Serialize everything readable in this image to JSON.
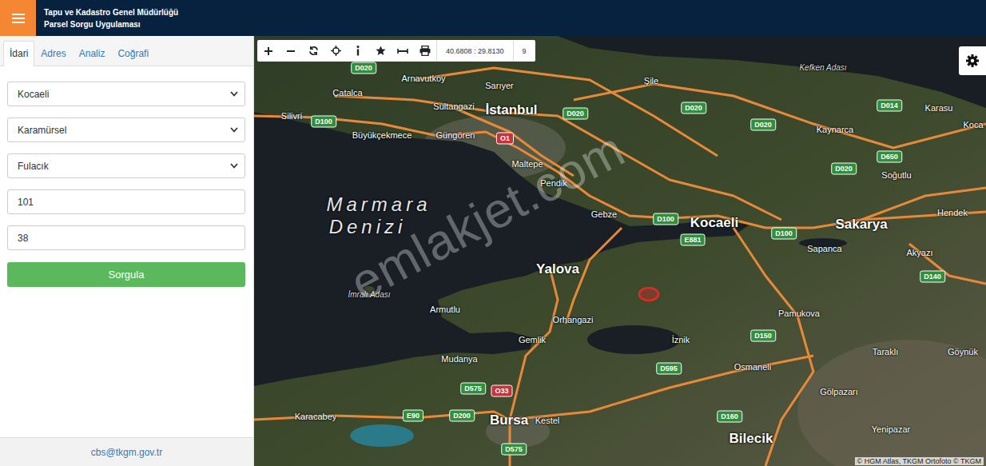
{
  "header": {
    "title_line1": "Tapu ve Kadastro Genel Müdürlüğü",
    "title_line2": "Parsel Sorgu Uygulaması"
  },
  "tabs": [
    {
      "label": "İdari",
      "selected": true
    },
    {
      "label": "Adres",
      "selected": false
    },
    {
      "label": "Analiz",
      "selected": false
    },
    {
      "label": "Coğrafi",
      "selected": false
    }
  ],
  "form": {
    "fields": [
      {
        "kind": "select",
        "value": "Kocaeli"
      },
      {
        "kind": "select",
        "value": "Karamürsel"
      },
      {
        "kind": "select",
        "value": "Fulacık"
      },
      {
        "kind": "input",
        "value": "101"
      },
      {
        "kind": "input",
        "value": "38"
      }
    ],
    "button": "Sorgula"
  },
  "footer": {
    "email": "cbs@tkgm.gov.tr"
  },
  "toolbar": {
    "coordinates": "40.6808 : 29.8130",
    "zoom": "9"
  },
  "map": {
    "places": [
      {
        "name": "Arnavutköy",
        "kind": "town"
      },
      {
        "name": "Sarıyer",
        "kind": "town"
      },
      {
        "name": "Şile",
        "kind": "town"
      },
      {
        "name": "Kefken Adası",
        "kind": "island"
      },
      {
        "name": "Çatalca",
        "kind": "town"
      },
      {
        "name": "Sultangazi",
        "kind": "town"
      },
      {
        "name": "İstanbul",
        "kind": "city"
      },
      {
        "name": "Karasu",
        "kind": "town"
      },
      {
        "name": "Koca",
        "kind": "town"
      },
      {
        "name": "Silivri",
        "kind": "town"
      },
      {
        "name": "Büyükçekmece",
        "kind": "town"
      },
      {
        "name": "Güngören",
        "kind": "town"
      },
      {
        "name": "Kaynarca",
        "kind": "town"
      },
      {
        "name": "Maltepe",
        "kind": "town"
      },
      {
        "name": "Soğutlu",
        "kind": "town"
      },
      {
        "name": "Pendik",
        "kind": "town"
      },
      {
        "name": "Marmara",
        "kind": "sea"
      },
      {
        "name": "Denizi",
        "kind": "sea"
      },
      {
        "name": "Gebze",
        "kind": "town"
      },
      {
        "name": "Kocaeli",
        "kind": "city"
      },
      {
        "name": "Sakarya",
        "kind": "city"
      },
      {
        "name": "Hendek",
        "kind": "town"
      },
      {
        "name": "Sapanca",
        "kind": "town"
      },
      {
        "name": "Akyazı",
        "kind": "town"
      },
      {
        "name": "Yalova",
        "kind": "city"
      },
      {
        "name": "İmralı Adası",
        "kind": "island"
      },
      {
        "name": "Armutlu",
        "kind": "town"
      },
      {
        "name": "Pamukova",
        "kind": "town"
      },
      {
        "name": "Orhangazi",
        "kind": "town"
      },
      {
        "name": "Gemlik",
        "kind": "town"
      },
      {
        "name": "İznik",
        "kind": "town"
      },
      {
        "name": "Taraklı",
        "kind": "town"
      },
      {
        "name": "Göynük",
        "kind": "town"
      },
      {
        "name": "Osmaneli",
        "kind": "town"
      },
      {
        "name": "Mudanya",
        "kind": "town"
      },
      {
        "name": "Gölpazarı",
        "kind": "town"
      },
      {
        "name": "Yenipazar",
        "kind": "town"
      },
      {
        "name": "Karacabey",
        "kind": "town"
      },
      {
        "name": "Bursa",
        "kind": "city"
      },
      {
        "name": "Kestel",
        "kind": "town"
      },
      {
        "name": "Bilecik",
        "kind": "city"
      }
    ],
    "road_shields": [
      {
        "label": "D020",
        "color": "#2f8f3c"
      },
      {
        "label": "D100",
        "color": "#2f8f3c"
      },
      {
        "label": "O1",
        "color": "#c4343a"
      },
      {
        "label": "D020",
        "color": "#2f8f3c"
      },
      {
        "label": "D020",
        "color": "#2f8f3c"
      },
      {
        "label": "D020",
        "color": "#2f8f3c"
      },
      {
        "label": "D014",
        "color": "#2f8f3c"
      },
      {
        "label": "D650",
        "color": "#2f8f3c"
      },
      {
        "label": "D020",
        "color": "#2f8f3c"
      },
      {
        "label": "D100",
        "color": "#2f8f3c"
      },
      {
        "label": "E881",
        "color": "#2f8f3c"
      },
      {
        "label": "D100",
        "color": "#2f8f3c"
      },
      {
        "label": "D140",
        "color": "#2f8f3c"
      },
      {
        "label": "D150",
        "color": "#2f8f3c"
      },
      {
        "label": "D595",
        "color": "#2f8f3c"
      },
      {
        "label": "D575",
        "color": "#2f8f3c"
      },
      {
        "label": "O33",
        "color": "#c4343a"
      },
      {
        "label": "E90",
        "color": "#2f8f3c"
      },
      {
        "label": "D200",
        "color": "#2f8f3c"
      },
      {
        "label": "D160",
        "color": "#2f8f3c"
      },
      {
        "label": "D575",
        "color": "#2f8f3c"
      }
    ],
    "attribution": "© HGM Atlas, TKGM Ortofoto © TKGM",
    "watermark": "emlakjet.com"
  }
}
